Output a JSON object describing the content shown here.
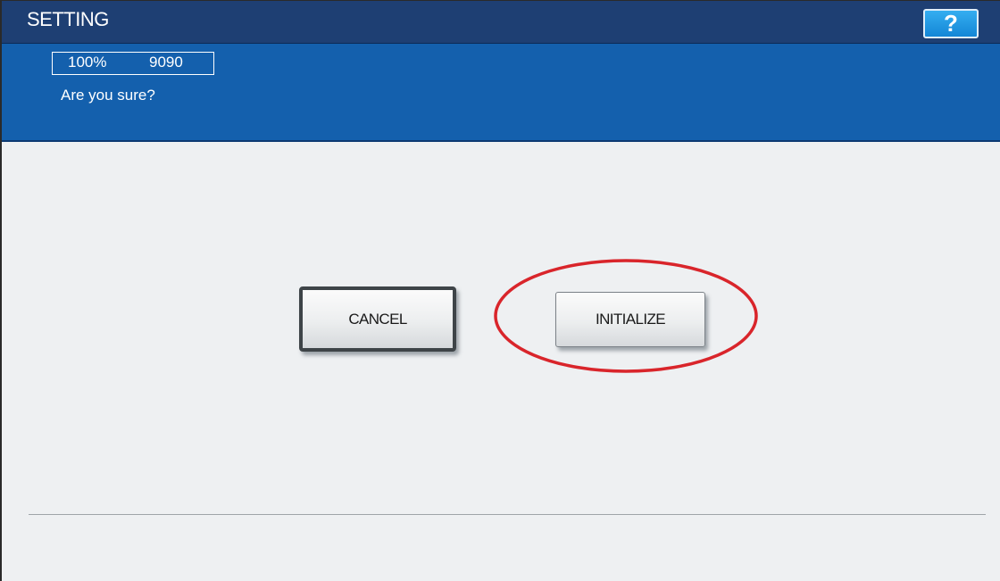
{
  "header": {
    "title": "SETTING",
    "help_label": "?"
  },
  "status": {
    "zoom": "100%",
    "copy_count": "9090",
    "message": "Are you sure?"
  },
  "dialog": {
    "cancel_label": "CANCEL",
    "initialize_label": "INITIALIZE"
  },
  "colors": {
    "title_bar": "#1e3f73",
    "info_bar": "#1460ad",
    "help_button": "#1e96e2",
    "highlight_ring": "#d9252b",
    "panel_background": "#eef0f2"
  },
  "icons": {
    "help": "question-mark-icon"
  }
}
